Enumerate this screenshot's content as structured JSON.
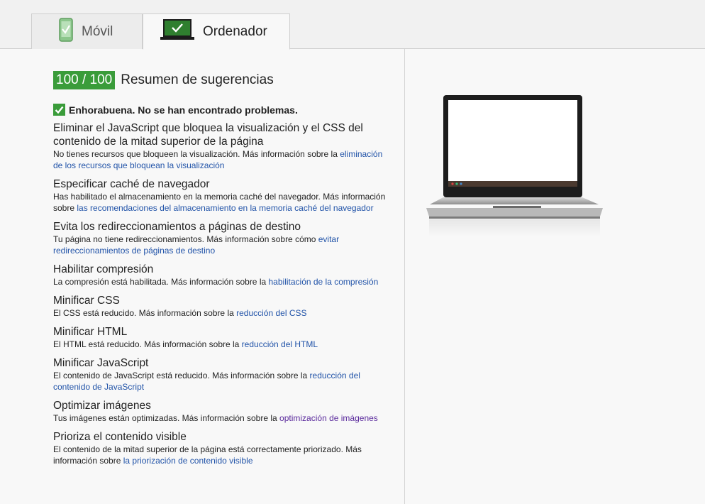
{
  "tabs": [
    {
      "label": "Móvil",
      "icon": "phone-check-icon",
      "active": false
    },
    {
      "label": "Ordenador",
      "icon": "laptop-check-icon",
      "active": true
    }
  ],
  "summary": {
    "score": "100 / 100",
    "title": "Resumen de sugerencias",
    "congrats": "Enhorabuena. No se han encontrado problemas."
  },
  "rules": [
    {
      "title": "Eliminar el JavaScript que bloquea la visualización y el CSS del contenido de la mitad superior de la página",
      "text": "No tienes recursos que bloqueen la visualización. Más información sobre la ",
      "link": "eliminación de los recursos que bloquean la visualización"
    },
    {
      "title": "Especificar caché de navegador",
      "text": "Has habilitado el almacenamiento en la memoria caché del navegador. Más información sobre ",
      "link": "las recomendaciones del almacenamiento en la memoria caché del navegador"
    },
    {
      "title": "Evita los redireccionamientos a páginas de destino",
      "text": "Tu página no tiene redireccionamientos. Más información sobre cómo ",
      "link": "evitar redireccionamientos de páginas de destino"
    },
    {
      "title": "Habilitar compresión",
      "text": "La compresión está habilitada. Más información sobre la ",
      "link": "habilitación de la compresión"
    },
    {
      "title": "Minificar CSS",
      "text": "El CSS está reducido. Más información sobre la ",
      "link": "reducción del CSS"
    },
    {
      "title": "Minificar HTML",
      "text": "El HTML está reducido. Más información sobre la ",
      "link": "reducción del HTML"
    },
    {
      "title": "Minificar JavaScript",
      "text": "El contenido de JavaScript está reducido. Más información sobre la ",
      "link": "reducción del contenido de JavaScript"
    },
    {
      "title": "Optimizar imágenes",
      "text": "Tus imágenes están optimizadas. Más información sobre la ",
      "link": "optimización de imágenes"
    },
    {
      "title": "Prioriza el contenido visible",
      "text": "El contenido de la mitad superior de la página está correctamente priorizado. Más información sobre ",
      "link": "la priorización de contenido visible"
    }
  ],
  "colors": {
    "score_bg": "#3a9c3a",
    "link": "#2153a8",
    "visited_link": "#5a2a9c"
  },
  "preview": {
    "icon": "laptop-preview-icon"
  }
}
